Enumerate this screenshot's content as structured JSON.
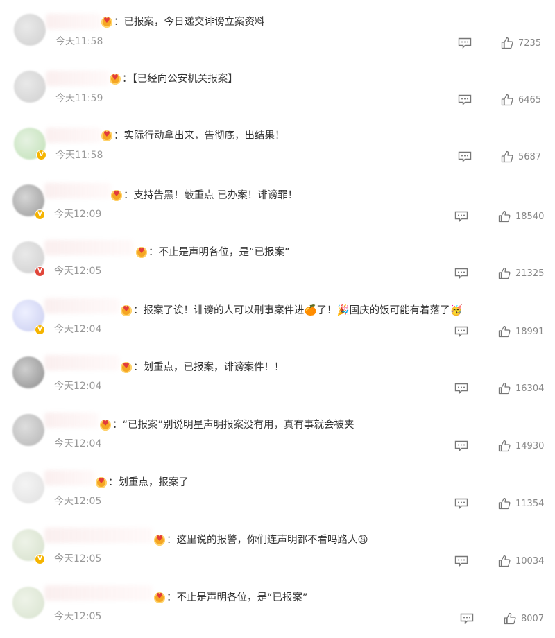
{
  "comments": [
    {
      "text": "：已报案，今日递交诽谤立案资料",
      "time": "今天11:58",
      "likes": "7235"
    },
    {
      "text": "：【已经向公安机关报案】",
      "time": "今天11:59",
      "likes": "6465"
    },
    {
      "text": "：实际行动拿出来，告彻底，出结果！",
      "time": "今天11:58",
      "likes": "5687"
    },
    {
      "text": "：支持告黑！敲重点 已办案！诽谤罪！",
      "time": "今天12:09",
      "likes": "18540"
    },
    {
      "text": "：不止是声明各位，是“已报案”",
      "time": "今天12:05",
      "likes": "21325"
    },
    {
      "text": "：报案了诶！诽谤的人可以刑事案件进🍊了！🎉国庆的饭可能有着落了🥳",
      "time": "今天12:04",
      "likes": "18991"
    },
    {
      "text": "：划重点，已报案，诽谤案件！！",
      "time": "今天12:04",
      "likes": "16304"
    },
    {
      "text": "：“已报案”别说明星声明报案没有用，真有事就会被夹",
      "time": "今天12:04",
      "likes": "14930"
    },
    {
      "text": "：划重点，报案了",
      "time": "今天12:05",
      "likes": "11354"
    },
    {
      "text": "：这里说的报警，你们连声明都不看吗路人😩",
      "time": "今天12:05",
      "likes": "10034"
    },
    {
      "text": "：不止是声明各位，是“已报案”",
      "time": "今天12:05",
      "likes": "8007"
    }
  ],
  "icons": {
    "reply": "comment-icon",
    "like": "thumbs-up-icon",
    "fan_badge": "fan-badge-icon",
    "verified": "verified-badge-icon"
  },
  "colors": {
    "text": "#333333",
    "meta": "#999999",
    "verified_gold": "#f5b400",
    "verified_red": "#e0463a"
  }
}
